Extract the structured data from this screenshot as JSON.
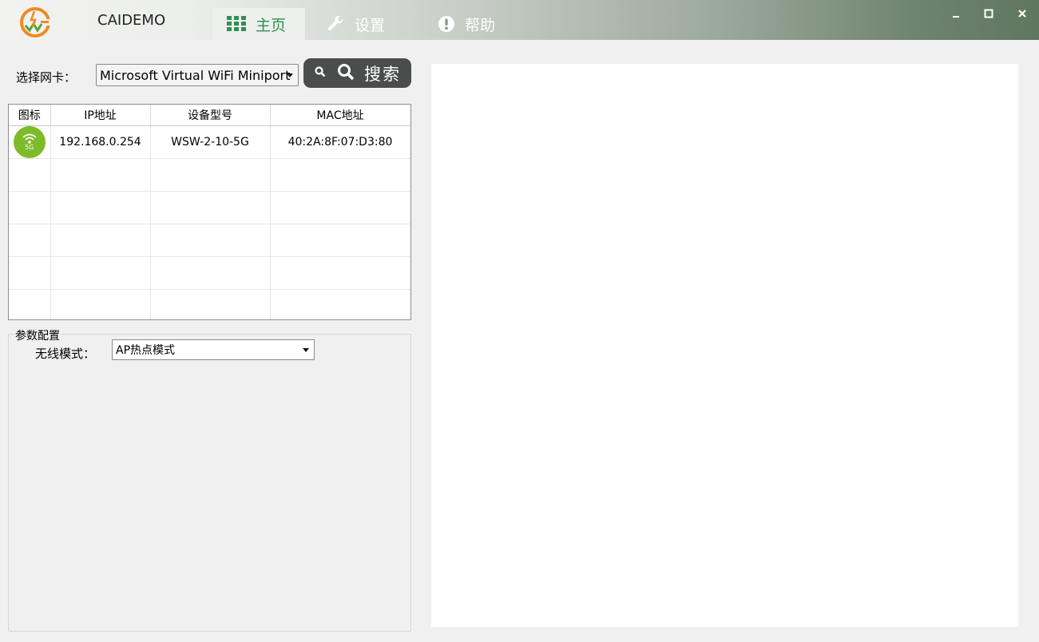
{
  "app": {
    "title": "CAIDEMO"
  },
  "tabs": [
    {
      "label": "主页",
      "icon": "grid-icon",
      "active": true
    },
    {
      "label": "设置",
      "icon": "wrench-icon",
      "active": false
    },
    {
      "label": "帮助",
      "icon": "exclamation-circle-icon",
      "active": false
    }
  ],
  "window_controls": {
    "minimize": "–",
    "maximize": "□",
    "close": "×"
  },
  "nic": {
    "label": "选择网卡：",
    "selected": "Microsoft Virtual WiFi Miniport"
  },
  "search": {
    "label": "搜索",
    "icons": [
      "search-small-icon",
      "search-icon"
    ]
  },
  "device_table": {
    "columns": [
      "图标",
      "IP地址",
      "设备型号",
      "MAC地址"
    ],
    "rows": [
      {
        "icon": "wifi-5g-icon",
        "icon_text": "5G",
        "ip": "192.168.0.254",
        "model": "WSW-2-10-5G",
        "mac": "40:2A:8F:07:D3:80"
      }
    ],
    "empty_rows": 5
  },
  "params": {
    "title": "参数配置",
    "mode_label": "无线模式：",
    "mode_value": "AP热点模式"
  },
  "colors": {
    "accent": "#2f8f4f",
    "search_bg": "#4a4d4c",
    "wifi_badge": "#7dbb2a",
    "logo_orange": "#f08a24"
  }
}
